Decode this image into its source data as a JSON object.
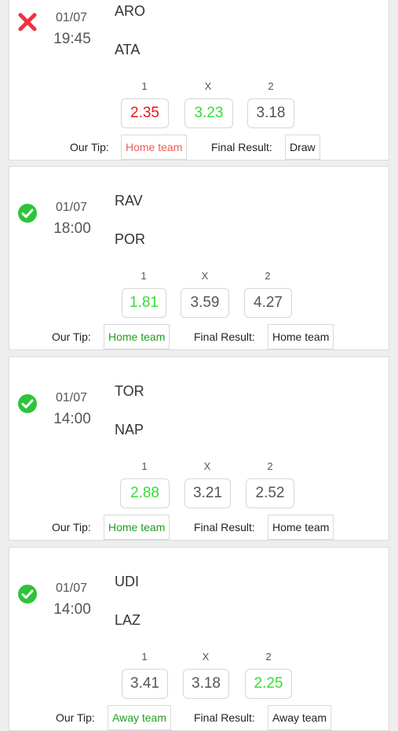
{
  "odds_headers": {
    "home": "1",
    "draw": "X",
    "away": "2"
  },
  "labels": {
    "tip": "Our Tip:",
    "result": "Final Result:"
  },
  "colors": {
    "win": "#2ec43a",
    "loss": "#f0313f",
    "odd_green": "#33e033",
    "odd_red": "#e31b1b"
  },
  "matches": [
    {
      "status": "loss",
      "status_icon": "red-x-icon",
      "date": "01/07",
      "time": "19:45",
      "home": "ARO",
      "away": "ATA",
      "odds": {
        "home": "2.35",
        "draw": "3.23",
        "away": "3.18"
      },
      "tip": "Home team",
      "result": "Draw"
    },
    {
      "status": "win",
      "status_icon": "green-check-icon",
      "date": "01/07",
      "time": "18:00",
      "home": "RAV",
      "away": "POR",
      "odds": {
        "home": "1.81",
        "draw": "3.59",
        "away": "4.27"
      },
      "tip": "Home team",
      "result": "Home team"
    },
    {
      "status": "win",
      "status_icon": "green-check-icon",
      "date": "01/07",
      "time": "14:00",
      "home": "TOR",
      "away": "NAP",
      "odds": {
        "home": "2.88",
        "draw": "3.21",
        "away": "2.52"
      },
      "tip": "Home team",
      "result": "Home team"
    },
    {
      "status": "win",
      "status_icon": "green-check-icon",
      "date": "01/07",
      "time": "14:00",
      "home": "UDI",
      "away": "LAZ",
      "odds": {
        "home": "3.41",
        "draw": "3.18",
        "away": "2.25"
      },
      "tip": "Away team",
      "result": "Away team"
    }
  ]
}
